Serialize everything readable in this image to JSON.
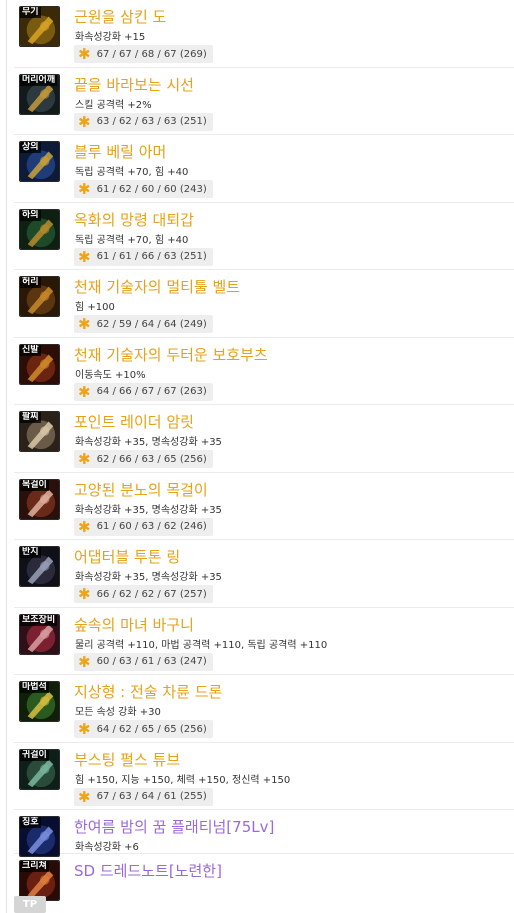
{
  "items": [
    {
      "slot": "무기",
      "name": "근원을 삼킨 도",
      "stat": "화속성강화 +15",
      "sf": "67 / 67 / 68 / 67 (269)",
      "icon": "weapon-sword-icon",
      "colors": [
        "#7a5a10",
        "#d9a526",
        "#3a2a08"
      ]
    },
    {
      "slot": "머리어깨",
      "name": "끝을 바라보는 시선",
      "stat": "스킬 공격력 +2%",
      "sf": "63 / 62 / 63 / 63 (251)",
      "icon": "shoulder-armor-icon",
      "colors": [
        "#2c3a40",
        "#c49a3a",
        "#121a1c"
      ]
    },
    {
      "slot": "상의",
      "name": "블루 베릴 아머",
      "stat": "독립 공격력 +70, 힘 +40",
      "sf": "61 / 62 / 60 / 60 (243)",
      "icon": "chest-armor-icon",
      "colors": [
        "#1f3c78",
        "#c9a23a",
        "#0d1a38"
      ]
    },
    {
      "slot": "하의",
      "name": "옥화의 망령 대퇴갑",
      "stat": "독립 공격력 +70, 힘 +40",
      "sf": "61 / 61 / 66 / 63 (251)",
      "icon": "leg-armor-icon",
      "colors": [
        "#1e4a2a",
        "#b98a2a",
        "#0e2012"
      ]
    },
    {
      "slot": "허리",
      "name": "천재 기술자의 멀티툴 벨트",
      "stat": "힘 +100",
      "sf": "62 / 59 / 64 / 64 (249)",
      "icon": "belt-icon",
      "colors": [
        "#5a3510",
        "#c88a2a",
        "#2a1806"
      ]
    },
    {
      "slot": "신발",
      "name": "천재 기술자의 두터운 보호부츠",
      "stat": "이동속도 +10%",
      "sf": "64 / 66 / 67 / 67 (263)",
      "icon": "boots-icon",
      "colors": [
        "#6a2410",
        "#d08a2a",
        "#2c0e06"
      ]
    },
    {
      "slot": "팔찌",
      "name": "포인트 레이더 암릿",
      "stat": "화속성강화 +35, 명속성강화 +35",
      "sf": "62 / 66 / 63 / 65 (256)",
      "icon": "bracelet-icon",
      "colors": [
        "#6a5a48",
        "#d8c8a8",
        "#2a2218"
      ]
    },
    {
      "slot": "목걸이",
      "name": "고양된 분노의 목걸이",
      "stat": "화속성강화 +35, 명속성강화 +35",
      "sf": "61 / 60 / 63 / 62 (246)",
      "icon": "necklace-icon",
      "colors": [
        "#6a2a1a",
        "#e0b0a0",
        "#2a100a"
      ]
    },
    {
      "slot": "반지",
      "name": "어댑터블 투톤 링",
      "stat": "화속성강화 +35, 명속성강화 +35",
      "sf": "66 / 62 / 62 / 67 (257)",
      "icon": "ring-icon",
      "colors": [
        "#2a2a3a",
        "#9aa0b8",
        "#101018"
      ]
    },
    {
      "slot": "보조장비",
      "name": "숲속의 마녀 바구니",
      "stat": "물리 공격력 +110, 마법 공격력 +110, 독립 공격력 +110",
      "sf": "60 / 63 / 61 / 63 (247)",
      "icon": "basket-icon",
      "colors": [
        "#7a2030",
        "#d8a0a0",
        "#301018"
      ]
    },
    {
      "slot": "마법석",
      "name": "지상형 : 전술 차륜 드론",
      "stat": "모든 속성 강화 +30",
      "sf": "64 / 62 / 65 / 65 (256)",
      "icon": "magic-stone-icon",
      "colors": [
        "#2a5a20",
        "#d8c040",
        "#102008"
      ]
    },
    {
      "slot": "귀걸이",
      "name": "부스팅 펄스 튜브",
      "stat": "힘 +150, 지능 +150, 체력 +150, 정신력 +150",
      "sf": "67 / 63 / 64 / 61 (255)",
      "icon": "earring-icon",
      "colors": [
        "#2a4a3a",
        "#7ab8a0",
        "#0e1e18"
      ]
    },
    {
      "slot": "칭호",
      "name": "한여름 밤의 꿈 플래티넘[75Lv]",
      "stat": "화속성강화 +6",
      "sf": "",
      "icon": "title-badge-icon",
      "colors": [
        "#1a2a6a",
        "#7a90e0",
        "#080e30"
      ],
      "purple": true
    },
    {
      "slot": "크리쳐",
      "name": "SD 드레드노트[노련한]",
      "stat": "",
      "sf": "",
      "icon": "creature-icon",
      "colors": [
        "#6a2010",
        "#e08040",
        "#2a0a04"
      ],
      "purple": true
    }
  ],
  "corner_badge": "TP",
  "colors": {
    "item_name": "#e6a21a",
    "purple_name": "#9a6ad8",
    "star": "#f1a317",
    "chip_bg": "#eeeeee"
  }
}
